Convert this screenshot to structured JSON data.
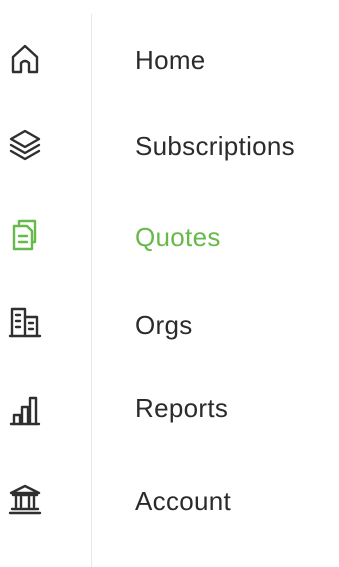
{
  "colors": {
    "text": "#2b2b2b",
    "icon": "#2f2f2f",
    "active": "#67b94b",
    "divider": "#e6e8eb"
  },
  "nav": {
    "items": [
      {
        "label": "Home",
        "icon": "home-icon",
        "active": false
      },
      {
        "label": "Subscriptions",
        "icon": "layers-icon",
        "active": false
      },
      {
        "label": "Quotes",
        "icon": "documents-icon",
        "active": true
      },
      {
        "label": "Orgs",
        "icon": "buildings-icon",
        "active": false
      },
      {
        "label": "Reports",
        "icon": "bar-chart-icon",
        "active": false
      },
      {
        "label": "Account",
        "icon": "bank-icon",
        "active": false
      }
    ]
  }
}
